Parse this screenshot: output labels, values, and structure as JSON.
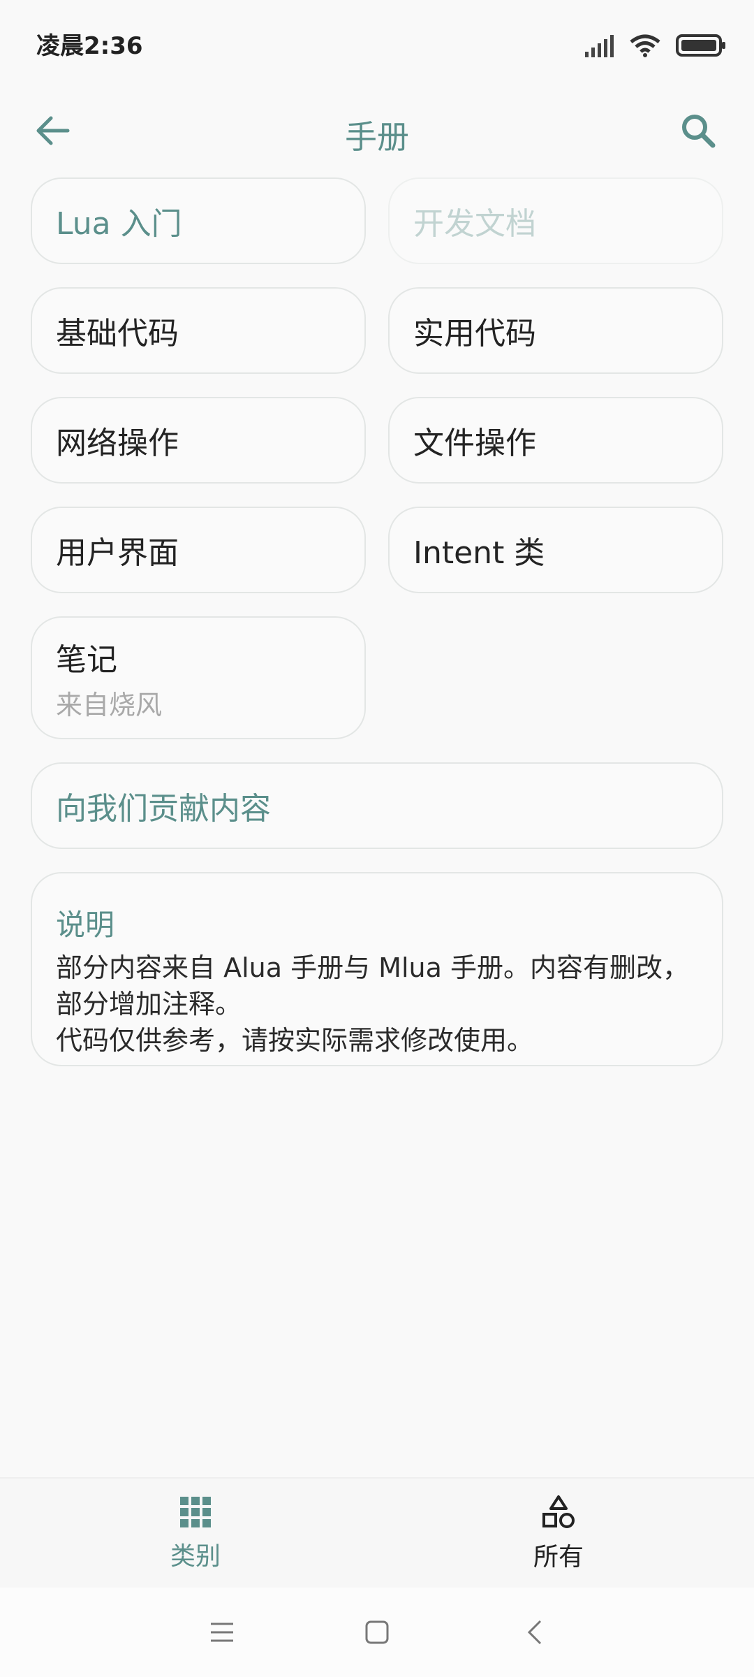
{
  "status": {
    "time": "凌晨2:36"
  },
  "appbar": {
    "title": "手册"
  },
  "categories": [
    {
      "label": "Lua 入门"
    },
    {
      "label": "开发文档"
    },
    {
      "label": "基础代码"
    },
    {
      "label": "实用代码"
    },
    {
      "label": "网络操作"
    },
    {
      "label": "文件操作"
    },
    {
      "label": "用户界面"
    },
    {
      "label": "Intent 类"
    },
    {
      "label": "笔记",
      "sub": "来自烧风"
    }
  ],
  "contribute": {
    "label": "向我们贡献内容"
  },
  "info": {
    "title": "说明",
    "body": "部分内容来自 Alua 手册与 Mlua 手册。内容有删改，部分增加注释。\n代码仅供参考，请按实际需求修改使用。"
  },
  "bottom_nav": {
    "items": [
      {
        "label": "类别",
        "icon": "grid-icon",
        "active": true
      },
      {
        "label": "所有",
        "icon": "shapes-icon",
        "active": false
      }
    ]
  },
  "colors": {
    "accent": "#5b8f8b",
    "background": "#f9f9f9",
    "disabled": "#c1d3d1"
  }
}
